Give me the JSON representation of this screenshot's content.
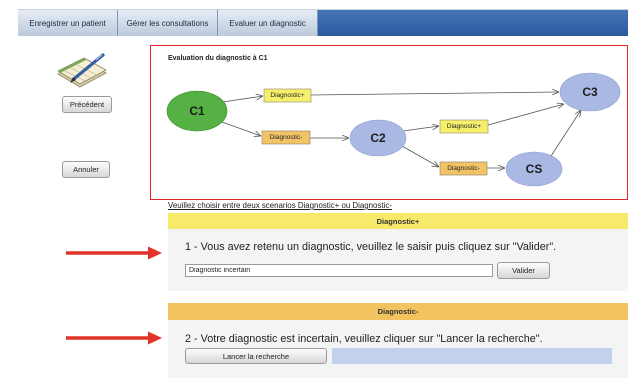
{
  "nav": {
    "tabs": [
      {
        "label": "Enregistrer un patient"
      },
      {
        "label": "Gérer les consultations"
      },
      {
        "label": "Evaluer un diagnostic"
      }
    ]
  },
  "sidebar": {
    "icon": "notepad-pen-icon",
    "previous_label": "Précédent",
    "cancel_label": "Annuler"
  },
  "diagram": {
    "title": "Evaluation du diagnostic à C1",
    "nodes": {
      "c1": "C1",
      "c2": "C2",
      "c3": "C3",
      "cs": "CS"
    },
    "edge_labels": {
      "c1_plus": "Diagnostic+",
      "c1_minus": "Diagnostic-",
      "c2_plus": "Diagnostic+",
      "c2_minus": "Diagnostic-"
    }
  },
  "instructions": {
    "link_text": "Veuillez choisir entre deux scenarios Diagnostic+ ou Diagnostic-"
  },
  "panel_plus": {
    "header": "Diagnostic+",
    "prompt": "1 - Vous avez retenu un diagnostic, veuillez le saisir puis cliquez sur \"Valider\".",
    "input_value": "Diagnostic incertain",
    "submit_label": "Valider"
  },
  "panel_minus": {
    "header": "Diagnostic-",
    "prompt": "2 - Votre diagnostic est incertain, veuillez cliquer sur \"Lancer la recherche\".",
    "search_label": "Lancer la recherche"
  },
  "annotations": {
    "arrow_icon": "red-arrow-right-icon"
  },
  "colors": {
    "nav_bar": "#2c5a9f",
    "diagram_border": "#e2262b",
    "node_green": "#55b144",
    "node_blue": "#aab9e4",
    "label_plus": "#f6ef6c",
    "label_minus": "#f2c468",
    "panel_plus_header": "#f7ea6b",
    "panel_minus_header": "#f2c35f",
    "callout_arrow": "#e2332b",
    "status_bar": "#c3d2ec"
  }
}
